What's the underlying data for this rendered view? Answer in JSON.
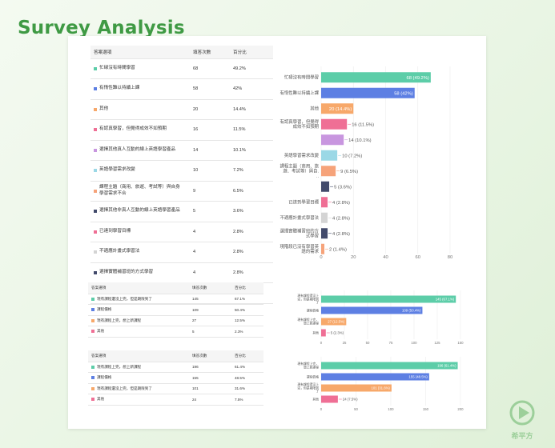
{
  "page_title": "Survey Analysis",
  "logo_text": "希平方",
  "colors": [
    "#5ccda8",
    "#5d7fe3",
    "#f7a86a",
    "#ef6f95",
    "#c896df",
    "#9bd8e6",
    "#f6a37a",
    "#424a6b",
    "#ef6f95",
    "#d4d4d4",
    "#424a6b",
    "#f6a37a"
  ],
  "tables": [
    {
      "headers": [
        "答案選項",
        "填答次數",
        "百分比"
      ],
      "rows": [
        {
          "label": "忙碌沒有時間學習",
          "count": "68",
          "pct": "49.2%"
        },
        {
          "label": "有惰性難以持續上課",
          "count": "58",
          "pct": "42%"
        },
        {
          "label": "其他",
          "count": "20",
          "pct": "14.4%"
        },
        {
          "label": "有認真學習，但覺得成效不如預期",
          "count": "16",
          "pct": "11.5%"
        },
        {
          "label": "選擇其他真人互動的線上英語學習產品",
          "count": "14",
          "pct": "10.1%"
        },
        {
          "label": "英語學習需求改變",
          "count": "10",
          "pct": "7.2%"
        },
        {
          "label": "課程主題（商用、旅遊、考試等）與自身學習需求不合",
          "count": "9",
          "pct": "6.5%"
        },
        {
          "label": "選擇其他非真人互動的線上英語學習產品",
          "count": "5",
          "pct": "3.6%"
        },
        {
          "label": "已達到學習目標",
          "count": "4",
          "pct": "2.8%"
        },
        {
          "label": "不適應計畫式學習法",
          "count": "4",
          "pct": "2.8%"
        },
        {
          "label": "選擇實體補習班的方式學習",
          "count": "4",
          "pct": "2.8%"
        },
        {
          "label": "現階段已沒有學習英語的需求",
          "count": "2",
          "pct": "1.4%"
        }
      ]
    },
    {
      "headers": [
        "答案選項",
        "填答次數",
        "百分比"
      ],
      "rows": [
        {
          "label": "現有課程還沒上完，但是期限到了",
          "count": "145",
          "pct": "67.1%"
        },
        {
          "label": "課程價格",
          "count": "109",
          "pct": "50.4%"
        },
        {
          "label": "現有課程上完，想上新課程",
          "count": "27",
          "pct": "12.5%"
        },
        {
          "label": "其他",
          "count": "5",
          "pct": "2.3%"
        }
      ]
    },
    {
      "headers": [
        "答案選項",
        "填答次數",
        "百分比"
      ],
      "rows": [
        {
          "label": "現有課程上完，想上新課程",
          "count": "196",
          "pct": "61.4%"
        },
        {
          "label": "課程價格",
          "count": "155",
          "pct": "48.5%"
        },
        {
          "label": "現有課程還沒上完，但是期限到了",
          "count": "101",
          "pct": "31.6%"
        },
        {
          "label": "其他",
          "count": "24",
          "pct": "7.5%"
        }
      ]
    }
  ],
  "chart_data": [
    {
      "type": "bar",
      "orientation": "horizontal",
      "categories": [
        "忙碌沒有時間學習",
        "有惰性難以持續上課",
        "其他",
        "有認真學習，但覺得成效不如預期",
        "",
        "英語學習需求改變",
        "課程主題（商用、旅遊、考試等）與自...",
        "",
        "已達到學習目標",
        "不適應計畫式學習法",
        "選擇實體補習班的方式學習",
        "現階段已沒有學習英語的需求"
      ],
      "values": [
        68,
        58,
        20,
        16,
        14,
        10,
        9,
        5,
        4,
        4,
        4,
        2
      ],
      "value_labels": [
        "68 (49.2%)",
        "58 (42%)",
        "20 (14.4%)",
        "16 (11.5%)",
        "14 (10.1%)",
        "10 (7.2%)",
        "9 (6.5%)",
        "5 (3.6%)",
        "4 (2.8%)",
        "4 (2.8%)",
        "4 (2.8%)",
        "2 (1.4%)"
      ],
      "xlim": [
        0,
        80
      ],
      "xticks": [
        "0",
        "20",
        "40",
        "60",
        "80"
      ]
    },
    {
      "type": "bar",
      "orientation": "horizontal",
      "categories": [
        "現有課程還沒上完，但是期限到了",
        "課程價格",
        "現有課程上完，想上新課程",
        "其他"
      ],
      "values": [
        145,
        109,
        27,
        5
      ],
      "value_labels": [
        "145 (67.1%)",
        "109 (50.4%)",
        "27 (12.5%)",
        "5 (2.3%)"
      ],
      "xlim": [
        0,
        150
      ],
      "xticks": [
        "0",
        "25",
        "50",
        "75",
        "100",
        "125",
        "150"
      ]
    },
    {
      "type": "bar",
      "orientation": "horizontal",
      "categories": [
        "現有課程上完，想上新課程",
        "課程價格",
        "現有課程還沒上完，但是期限到了",
        "其他"
      ],
      "values": [
        196,
        155,
        101,
        24
      ],
      "value_labels": [
        "196 (61.4%)",
        "155 (48.5%)",
        "101 (31.6%)",
        "24 (7.5%)"
      ],
      "xlim": [
        0,
        200
      ],
      "xticks": [
        "0",
        "50",
        "100",
        "150",
        "200"
      ]
    }
  ]
}
